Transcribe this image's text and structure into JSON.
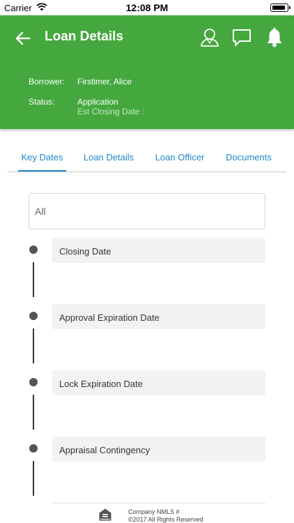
{
  "status_bar": {
    "carrier": "Carrier",
    "time": "12:08 PM"
  },
  "header": {
    "title": "Loan Details",
    "borrower_label": "Borrower:",
    "borrower_value": "Firstimer, Alice",
    "status_label": "Status:",
    "status_value": "Application",
    "closing_label": "Est Closing Date :"
  },
  "tabs": [
    {
      "label": "Key Dates",
      "active": true
    },
    {
      "label": "Loan Details",
      "active": false
    },
    {
      "label": "Loan Officer",
      "active": false
    },
    {
      "label": "Documents",
      "active": false
    }
  ],
  "filter": {
    "value": "All"
  },
  "timeline": [
    {
      "label": "Closing Date"
    },
    {
      "label": "Approval Expiration Date"
    },
    {
      "label": "Lock Expiration Date"
    },
    {
      "label": "Appraisal Contingency"
    }
  ],
  "footer": {
    "nmls": "Company NMLS #",
    "copyright": "©2017  All Rights Reserved"
  },
  "colors": {
    "header_green": "#44a83e",
    "tab_blue": "#1e88c8",
    "card_bg": "#f2f2f2"
  },
  "icons": [
    "wifi-icon",
    "battery-icon",
    "back-arrow-icon",
    "loan-officer-icon",
    "chat-icon",
    "bell-icon",
    "equal-housing-lender-icon"
  ]
}
